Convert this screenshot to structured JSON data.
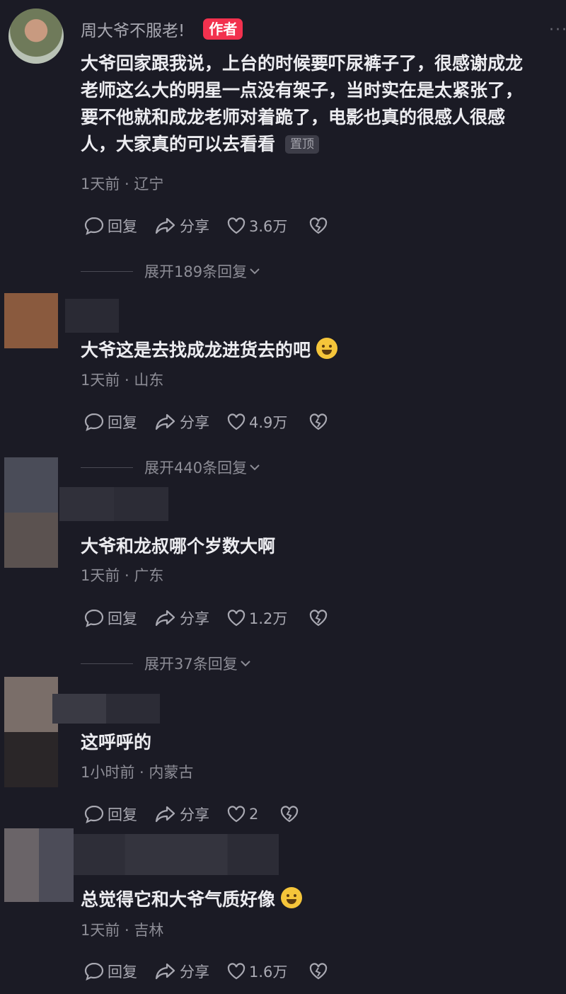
{
  "comments": [
    {
      "author": "周大爷不服老!",
      "badge": "作者",
      "lines": [
        "大爷回家跟我说，上台的时候要吓尿裤子了，很感谢成龙",
        "老师这么大的明星一点没有架子，当时实在是太紧张了，",
        "要不他就和成龙老师对着跪了，电影也真的很感人很感",
        "人，大家真的可以去看看"
      ],
      "pin_label": "置顶",
      "meta": "1天前 · 辽宁",
      "reply_label": "回复",
      "share_label": "分享",
      "likes": "3.6万",
      "expand": "展开189条回复"
    },
    {
      "text": "大爷这是去找成龙进货去的吧",
      "emoji": "laugh-emoji",
      "meta": "1天前 · 山东",
      "reply_label": "回复",
      "share_label": "分享",
      "likes": "4.9万",
      "expand": "展开440条回复"
    },
    {
      "text": "大爷和龙叔哪个岁数大啊",
      "meta": "1天前 · 广东",
      "reply_label": "回复",
      "share_label": "分享",
      "likes": "1.2万",
      "expand": "展开37条回复"
    },
    {
      "text": "这呼呼的",
      "meta": "1小时前 · 内蒙古",
      "reply_label": "回复",
      "share_label": "分享",
      "likes": "2"
    },
    {
      "text": "总觉得它和大爷气质好像",
      "emoji": "rofl-emoji",
      "meta": "1天前 · 吉林",
      "reply_label": "回复",
      "share_label": "分享",
      "likes": "1.6万"
    }
  ],
  "icons": {
    "reply": "comment-bubble-icon",
    "share": "share-arrow-icon",
    "like": "heart-icon",
    "dislike": "broken-heart-icon",
    "expand": "chevron-down-icon",
    "more": "more-dots-icon"
  },
  "colors": {
    "background": "#1b1b25",
    "badge": "#f2314e",
    "text": "#ececf0",
    "meta": "#8d8d96"
  }
}
